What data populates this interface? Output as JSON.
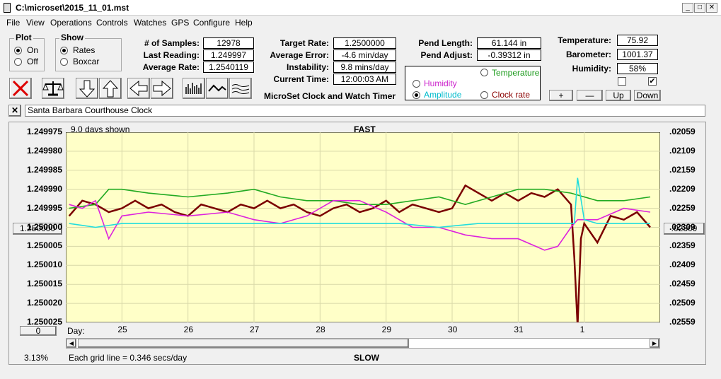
{
  "window": {
    "title": "C:\\microset\\2015_11_01.mst"
  },
  "menu": [
    "File",
    "View",
    "Operations",
    "Controls",
    "Watches",
    "GPS",
    "Configure",
    "Help"
  ],
  "plot": {
    "title": "Plot",
    "on": "On",
    "off": "Off",
    "selected": "On"
  },
  "show": {
    "title": "Show",
    "rates": "Rates",
    "boxcar": "Boxcar",
    "selected": "Rates"
  },
  "stats": {
    "samples_label": "# of Samples:",
    "samples": "12978",
    "last_label": "Last Reading:",
    "last": "1.249997",
    "avg_label": "Average Rate:",
    "avg": "1.2540119"
  },
  "rates": {
    "target_label": "Target Rate:",
    "target": "1.2500000",
    "avg_err_label": "Average Error:",
    "avg_err": "-4.6 min/day",
    "instab_label": "Instability:",
    "instab": "9.8 mins/day",
    "time_label": "Current Time:",
    "time": "12:00:03 AM"
  },
  "app_name": "MicroSet Clock and Watch Timer",
  "pend": {
    "length_label": "Pend Length:",
    "length": "61.144 in",
    "adjust_label": "Pend Adjust:",
    "adjust": "-0.39312 in"
  },
  "plot_select": {
    "temperature": "Temperature",
    "humidity": "Humidity",
    "amplitude": "Amplitude",
    "clock_rate": "Clock rate",
    "selected": "Amplitude"
  },
  "env": {
    "temp_label": "Temperature:",
    "temp": "75.92",
    "baro_label": "Barometer:",
    "baro": "1001.37",
    "hum_label": "Humidity:",
    "hum": "58%"
  },
  "buttons": {
    "plus": "+",
    "minus": "—",
    "up": "Up",
    "down": "Down"
  },
  "checks": {
    "left": false,
    "right": true
  },
  "clock_name": "Santa Barbara Courthouse Clock",
  "chart_labels": {
    "days_shown": "9.0 days shown",
    "top": "FAST",
    "bottom": "SLOW",
    "grid_note": "Each grid line = 0.346 secs/day",
    "percent": "3.13%",
    "day_label": "Day:",
    "left_box": "1.250000",
    "right_box": ".02309",
    "zero_box": "0"
  },
  "colors": {
    "rate": "#7a0000",
    "temperature": "#22aa22",
    "humidity": "#dd22dd",
    "amplitude": "#22dddd",
    "plot_bg": "#ffffc8"
  },
  "chart_data": {
    "type": "line",
    "y_left_ticks": [
      "1.249975",
      "1.249980",
      "1.249985",
      "1.249990",
      "1.249995",
      "1.250000",
      "1.250005",
      "1.250010",
      "1.250015",
      "1.250020",
      "1.250025"
    ],
    "y_right_ticks": [
      ".02059",
      ".02109",
      ".02159",
      ".02209",
      ".02259",
      ".02309",
      ".02359",
      ".02409",
      ".02459",
      ".02509",
      ".02559"
    ],
    "x_ticks": [
      "25",
      "26",
      "27",
      "28",
      "29",
      "30",
      "31",
      "1"
    ],
    "ylim_left": [
      1.249975,
      1.250025
    ],
    "ylim_right": [
      0.02059,
      0.02559
    ],
    "x_range": [
      24.15,
      33.15
    ],
    "series": [
      {
        "key": "rate",
        "x": [
          24.2,
          24.4,
          24.6,
          24.8,
          25.0,
          25.2,
          25.4,
          25.6,
          25.8,
          26.0,
          26.2,
          26.4,
          26.6,
          26.8,
          27.0,
          27.2,
          27.4,
          27.6,
          27.8,
          28.0,
          28.2,
          28.4,
          28.6,
          28.8,
          29.0,
          29.2,
          29.4,
          29.6,
          29.8,
          30.0,
          30.2,
          30.4,
          30.6,
          30.8,
          31.0,
          31.2,
          31.4,
          31.6,
          31.8,
          31.85,
          31.9,
          31.95,
          32.0,
          32.2,
          32.4,
          32.6,
          32.8,
          33.0
        ],
        "y": [
          1.249997,
          1.249993,
          1.249994,
          1.249996,
          1.249995,
          1.249993,
          1.249995,
          1.249994,
          1.249996,
          1.249997,
          1.249994,
          1.249995,
          1.249996,
          1.249994,
          1.249995,
          1.249993,
          1.249995,
          1.249994,
          1.249996,
          1.249997,
          1.249995,
          1.249994,
          1.249996,
          1.249995,
          1.249993,
          1.249996,
          1.249994,
          1.249995,
          1.249996,
          1.249995,
          1.249989,
          1.249991,
          1.249993,
          1.249991,
          1.249993,
          1.249991,
          1.249992,
          1.24999,
          1.249994,
          1.250008,
          1.250026,
          1.250003,
          1.249999,
          1.250004,
          1.249997,
          1.249998,
          1.249996,
          1.25
        ]
      },
      {
        "key": "temperature",
        "x": [
          24.2,
          24.6,
          24.8,
          25.0,
          25.4,
          26.0,
          26.6,
          27.0,
          27.4,
          27.8,
          28.2,
          28.6,
          29.0,
          29.4,
          29.8,
          30.2,
          30.6,
          31.0,
          31.4,
          31.8,
          32.2,
          32.6,
          33.0
        ],
        "y": [
          1.249995,
          1.249994,
          1.24999,
          1.24999,
          1.249991,
          1.249992,
          1.249991,
          1.24999,
          1.249992,
          1.249993,
          1.249993,
          1.249994,
          1.249994,
          1.249993,
          1.249992,
          1.249994,
          1.249992,
          1.24999,
          1.24999,
          1.249991,
          1.249993,
          1.249993,
          1.249992
        ]
      },
      {
        "key": "humidity",
        "x": [
          24.2,
          24.4,
          24.6,
          24.8,
          25.0,
          25.4,
          26.0,
          26.6,
          27.0,
          27.4,
          27.8,
          28.2,
          28.6,
          29.0,
          29.4,
          29.8,
          30.2,
          30.6,
          31.0,
          31.4,
          31.6,
          31.8,
          31.9,
          32.2,
          32.6,
          33.0
        ],
        "y": [
          1.249994,
          1.249995,
          1.249993,
          1.250003,
          1.249997,
          1.249996,
          1.249997,
          1.249996,
          1.249998,
          1.249999,
          1.249997,
          1.249993,
          1.249993,
          1.249996,
          1.25,
          1.25,
          1.250002,
          1.250003,
          1.250003,
          1.250006,
          1.250005,
          1.25,
          1.249998,
          1.249998,
          1.249995,
          1.249996
        ]
      },
      {
        "key": "amplitude",
        "x": [
          24.2,
          24.6,
          25.0,
          25.6,
          26.2,
          26.8,
          27.4,
          28.0,
          28.6,
          29.2,
          29.8,
          30.4,
          31.0,
          31.4,
          31.7,
          31.85,
          31.9,
          32.0,
          32.2,
          32.6,
          33.0
        ],
        "y": [
          1.249999,
          1.25,
          1.249999,
          1.249999,
          1.249999,
          1.249999,
          1.249999,
          1.249999,
          1.249999,
          1.249999,
          1.25,
          1.249999,
          1.249999,
          1.249999,
          1.249999,
          1.249999,
          1.249987,
          1.249998,
          1.249999,
          1.249999,
          1.249999
        ]
      }
    ]
  }
}
